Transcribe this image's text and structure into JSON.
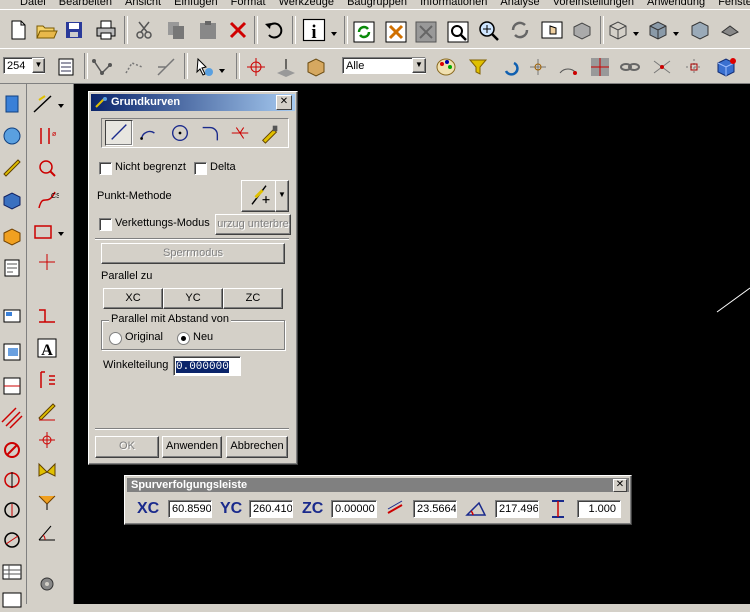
{
  "menu": [
    "Datei",
    "Bearbeiten",
    "Ansicht",
    "Einfügen",
    "Format",
    "Werkzeuge",
    "Baugruppen",
    "Informationen",
    "Analyse",
    "Voreinstellungen",
    "Anwendung",
    "Fenster"
  ],
  "toolbar2": {
    "layer_value": "254",
    "filter_value": "Alle"
  },
  "dialog": {
    "title": "Grundkurven",
    "close_label": "✕",
    "nicht_begrenzt": "Nicht begrenzt",
    "delta": "Delta",
    "punkt_methode": "Punkt-Methode",
    "verkettungs_modus": "Verkettungs-Modus",
    "bezug_button": "urzug unterbre",
    "sperrmodus": "Sperrmodus",
    "parallel_zu": "Parallel zu",
    "xc": "XC",
    "yc": "YC",
    "zc": "ZC",
    "parallel_abstand": "Parallel mit Abstand von",
    "original": "Original",
    "neu": "Neu",
    "winkelteilung": "Winkelteilung",
    "winkel_value": "0.000000",
    "ok": "OK",
    "anwenden": "Anwenden",
    "abbrechen": "Abbrechen"
  },
  "tracking": {
    "title": "Spurverfolgungsleiste",
    "close_label": "✕",
    "xc_label": "XC",
    "xc_value": "60.8590",
    "yc_label": "YC",
    "yc_value": "260.410",
    "zc_label": "ZC",
    "zc_value": "0.00000",
    "length_value": "23.5664",
    "angle_value": "217.496",
    "scale_value": "1.000"
  },
  "colors": {
    "canvas": "#000000",
    "window": "#d4d0c8",
    "title_start": "#0a246a",
    "title_end": "#a6caf0",
    "label_blue": "#1a2a8c"
  }
}
